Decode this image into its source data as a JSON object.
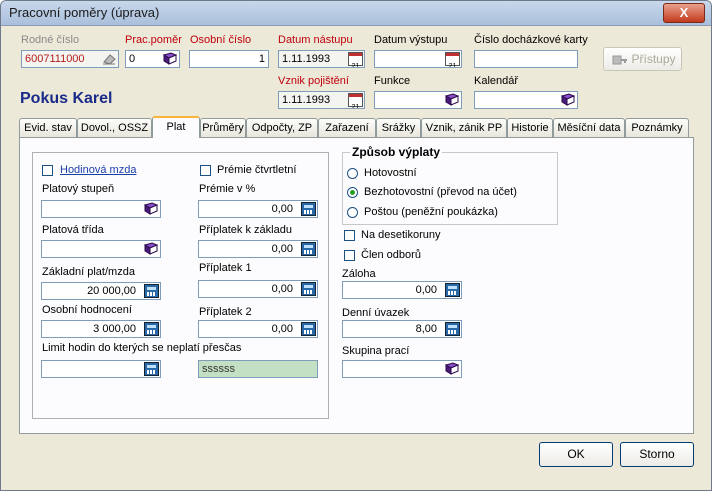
{
  "window": {
    "title": "Pracovní poměry (úprava)",
    "close_glyph": "X"
  },
  "header": {
    "rodne_cislo": {
      "label": "Rodné číslo",
      "value": "6007111000"
    },
    "prac_pomer": {
      "label": "Prac.poměr",
      "value": "0"
    },
    "osobni_cislo": {
      "label": "Osobní číslo",
      "value": "1"
    },
    "datum_nastupu": {
      "label": "Datum nástupu",
      "value": "1.11.1993"
    },
    "datum_vystupu": {
      "label": "Datum výstupu",
      "value": ""
    },
    "cislo_karty": {
      "label": "Číslo docházkové karty",
      "value": ""
    },
    "pristupy_label": "Přístupy",
    "vznik_pojisteni": {
      "label": "Vznik pojištění",
      "value": "1.11.1993"
    },
    "funkce": {
      "label": "Funkce",
      "value": ""
    },
    "kalendar": {
      "label": "Kalendář",
      "value": ""
    },
    "employee_name": "Pokus Karel"
  },
  "tabs": [
    {
      "label": "Evid. stav"
    },
    {
      "label": "Dovol., OSSZ"
    },
    {
      "label": "Plat"
    },
    {
      "label": "Průměry"
    },
    {
      "label": "Odpočty, ZP"
    },
    {
      "label": "Zařazení"
    },
    {
      "label": "Srážky"
    },
    {
      "label": "Vznik, zánik PP"
    },
    {
      "label": "Historie"
    },
    {
      "label": "Měsíční data"
    },
    {
      "label": "Poznámky"
    }
  ],
  "plat": {
    "hodinova_mzda": {
      "label": "Hodinová mzda",
      "checked": false
    },
    "platovy_stupen": {
      "label": "Platový stupeň",
      "value": ""
    },
    "platova_trida": {
      "label": "Platová třída",
      "value": ""
    },
    "zakladni_plat": {
      "label": "Základní plat/mzda",
      "value": "20 000,00"
    },
    "osobni_hodnoceni": {
      "label": "Osobní hodnocení",
      "value": "3 000,00"
    },
    "limit_hodin": {
      "label": "Limit hodin do kterých se neplatí přesčas",
      "value": ""
    },
    "premie_ctvrtletni": {
      "label": "Prémie čtvrtletní",
      "checked": false
    },
    "premie_pct": {
      "label": "Prémie v %",
      "value": "0,00"
    },
    "priplatek_k_zakladu": {
      "label": "Příplatek k základu",
      "value": "0,00"
    },
    "priplatek_1": {
      "label": "Příplatek 1",
      "value": "0,00"
    },
    "priplatek_2": {
      "label": "Příplatek 2",
      "value": "0,00"
    },
    "green_field": "ssssss"
  },
  "zpusob": {
    "title": "Způsob výplaty",
    "options": [
      {
        "label": "Hotovostní",
        "selected": false
      },
      {
        "label": "Bezhotovostní (převod na účet)",
        "selected": true
      },
      {
        "label": "Poštou (peněžní poukázka)",
        "selected": false
      }
    ],
    "na_desetikoruny": {
      "label": "Na desetikoruny",
      "checked": false
    },
    "clen_odboru": {
      "label": "Člen odborů",
      "checked": false
    },
    "zaloha": {
      "label": "Záloha",
      "value": "0,00"
    },
    "denni_uvazek": {
      "label": "Denní úvazek",
      "value": "8,00"
    },
    "skupina_praci": {
      "label": "Skupina prací",
      "value": ""
    }
  },
  "buttons": {
    "ok": "OK",
    "storno": "Storno"
  },
  "colors": {
    "required_label": "#c0000c",
    "disabled_label": "#8a8a8a",
    "name": "#1a2b8a",
    "active_tab_accent": "#f7b33c",
    "green_field": "#c4e0c4"
  }
}
